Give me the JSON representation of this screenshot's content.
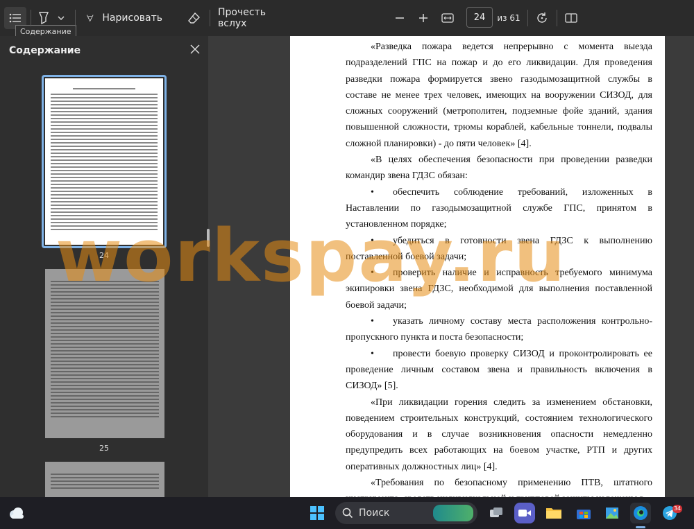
{
  "toolbar": {
    "draw_label": "Нарисовать",
    "read_aloud_label": "Прочесть вслух",
    "page_current": "24",
    "page_total": "из 61",
    "tooltip": "Содержание"
  },
  "sidebar": {
    "title": "Содержание",
    "thumbnails": [
      {
        "page": "24",
        "selected": true
      },
      {
        "page": "25",
        "selected": false
      }
    ]
  },
  "document": {
    "paragraphs": [
      {
        "type": "indent",
        "text": "«Разведка пожара ведется непрерывно с момента выезда подразделений ГПС на пожар и до его ликвидации. Для проведения разведки пожара формируется звено газодымозащитной службы в составе не менее трех человек, имеющих на вооружении СИЗОД, для сложных сооружений (метрополитен, подземные фойе зданий, здания повышенной сложности, трюмы кораблей, кабельные тоннели, подвалы сложной планировки) - до пяти человек» [4]."
      },
      {
        "type": "indent",
        "text": "«В целях обеспечения безопасности при проведении разведки командир звена ГДЗС обязан:"
      },
      {
        "type": "bullet",
        "text": "обеспечить соблюдение требований, изложенных в Наставлении по газодымозащитной службе ГПС, принятом в установленном порядке;"
      },
      {
        "type": "bullet",
        "text": "убедиться в готовности звена ГДЗС к выполнению поставленной боевой задачи;"
      },
      {
        "type": "bullet",
        "text": "проверить наличие и исправность требуемого минимума экипировки звена ГДЗС, необходимой для выполнения поставленной боевой задачи;"
      },
      {
        "type": "bullet",
        "text": "указать личному составу места расположения контрольно-пропускного пункта и поста безопасности;"
      },
      {
        "type": "bullet",
        "text": "провести боевую проверку СИЗОД и проконтролировать ее проведение личным составом звена и правильность включения в СИЗОД» [5]."
      },
      {
        "type": "indent",
        "text": "«При ликвидации горения следить за изменением обстановки, поведением строительных конструкций, состоянием технологического оборудования и в случае возникновения опасности немедленно предупредить всех работающих на боевом участке, РТП и других оперативных должностных лиц» [4]."
      },
      {
        "type": "indent",
        "text": "«Требования по безопасному применению ПТВ, штатного инструмента, средств индивидуальной и групповой защиты изложены в"
      }
    ]
  },
  "watermark": "workspay.ru",
  "taskbar": {
    "search_label": "Поиск",
    "telegram_badge": "34"
  }
}
